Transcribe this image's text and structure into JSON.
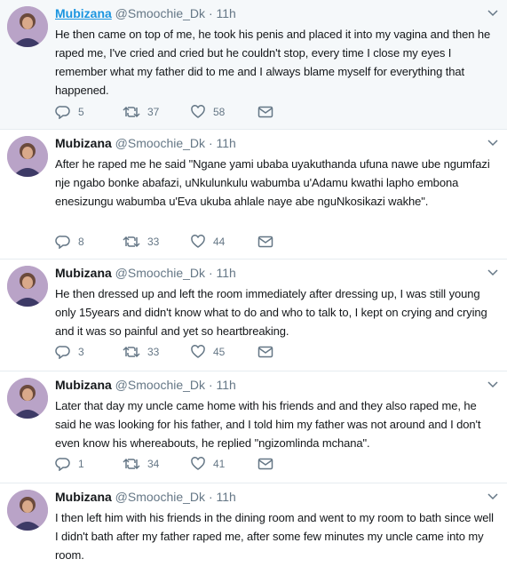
{
  "tweets": [
    {
      "name": "Mubizana",
      "handle": "@Smoochie_Dk",
      "sep": "·",
      "time": "11h",
      "text": "He then came on top of me, he took his penis and placed it into my vagina and then he raped me, I've cried and cried but he couldn't stop, every time I close my eyes I remember what my father did to me and I always blame myself for everything that happened.",
      "replies": "5",
      "retweets": "37",
      "likes": "58"
    },
    {
      "name": "Mubizana",
      "handle": "@Smoochie_Dk",
      "sep": "·",
      "time": "11h",
      "text": "After he raped me he said \"Ngane yami ubaba uyakuthanda ufuna nawe ube ngumfazi nje ngabo bonke abafazi, uNkulunkulu wabumba u'Adamu kwathi lapho embona enesizungu wabumba u'Eva ukuba ahlale naye abe nguNkosikazi wakhe\".",
      "replies": "8",
      "retweets": "33",
      "likes": "44"
    },
    {
      "name": "Mubizana",
      "handle": "@Smoochie_Dk",
      "sep": "·",
      "time": "11h",
      "text": "He then dressed up and left the room immediately after dressing up, I was still young only 15years and didn't know what to do and who to talk to, I kept on crying and crying and it was so painful and yet so heartbreaking.",
      "replies": "3",
      "retweets": "33",
      "likes": "45"
    },
    {
      "name": "Mubizana",
      "handle": "@Smoochie_Dk",
      "sep": "·",
      "time": "11h",
      "text": "Later that day my uncle came home with his friends and and they also raped me, he said he was looking for his father, and I told him my father was not around and I don't even know his whereabouts, he replied \"ngizomlinda mchana\".",
      "replies": "1",
      "retweets": "34",
      "likes": "41"
    },
    {
      "name": "Mubizana",
      "handle": "@Smoochie_Dk",
      "sep": "·",
      "time": "11h",
      "text": "I then left him with his friends in the dining room and went to my room to bath since well I didn't bath after my father raped me, after some few minutes my uncle came into my room."
    }
  ],
  "icons": {
    "reply": "reply-icon",
    "retweet": "retweet-icon",
    "like": "heart-icon",
    "dm": "envelope-icon",
    "caret": "chevron-down-icon"
  },
  "colors": {
    "link": "#1b95e0",
    "muted": "#657786",
    "divider": "#e6ecf0",
    "highlight_bg": "#f5f8fa"
  }
}
